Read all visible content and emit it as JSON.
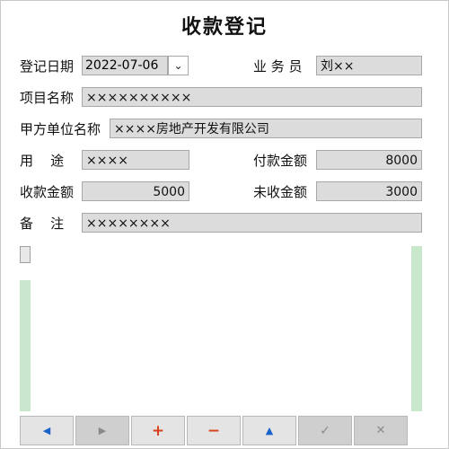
{
  "title": "收款登记",
  "labels": {
    "reg_date": "登记日期",
    "staff": "业 务 员",
    "project_name": "项目名称",
    "party_a": "甲方单位名称",
    "purpose": "用    途",
    "pay_amount": "付款金额",
    "recv_amount": "收款金额",
    "unrecv_amount": "未收金额",
    "remark": "备    注"
  },
  "values": {
    "reg_date": "2022-07-06",
    "staff": "刘××",
    "project_name": "××××××××××",
    "party_a": "××××房地产开发有限公司",
    "purpose": "××××",
    "pay_amount": "8000",
    "recv_amount": "5000",
    "unrecv_amount": "3000",
    "remark": "××××××××"
  },
  "icons": {
    "date_dropdown": "⌄",
    "prev": "◀",
    "next": "▶",
    "add": "+",
    "delete": "−",
    "up": "▲",
    "confirm": "✓",
    "cancel": "✕"
  },
  "colors": {
    "blue_icon": "#1a63c9",
    "red_icon": "#d8421c",
    "gray_icon": "#8a8a8a",
    "green_panel": "#c9e7cc"
  }
}
